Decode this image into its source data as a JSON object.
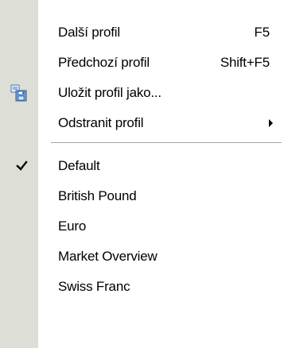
{
  "menu": {
    "items": [
      {
        "label": "Další profil",
        "shortcut": "F5",
        "icon": null,
        "checked": false,
        "submenu": false
      },
      {
        "label": "Předchozí profil",
        "shortcut": "Shift+F5",
        "icon": null,
        "checked": false,
        "submenu": false
      },
      {
        "label": "Uložit profil jako...",
        "shortcut": "",
        "icon": "save-profile-icon",
        "checked": false,
        "submenu": false
      },
      {
        "label": "Odstranit profil",
        "shortcut": "",
        "icon": null,
        "checked": false,
        "submenu": true
      }
    ],
    "profiles": [
      {
        "label": "Default",
        "checked": true
      },
      {
        "label": "British Pound",
        "checked": false
      },
      {
        "label": "Euro",
        "checked": false
      },
      {
        "label": "Market Overview",
        "checked": false
      },
      {
        "label": "Swiss Franc",
        "checked": false
      }
    ]
  },
  "colors": {
    "gutter": "#dddfd7",
    "separator": "#a9a9a9",
    "background": "#ffffff"
  }
}
